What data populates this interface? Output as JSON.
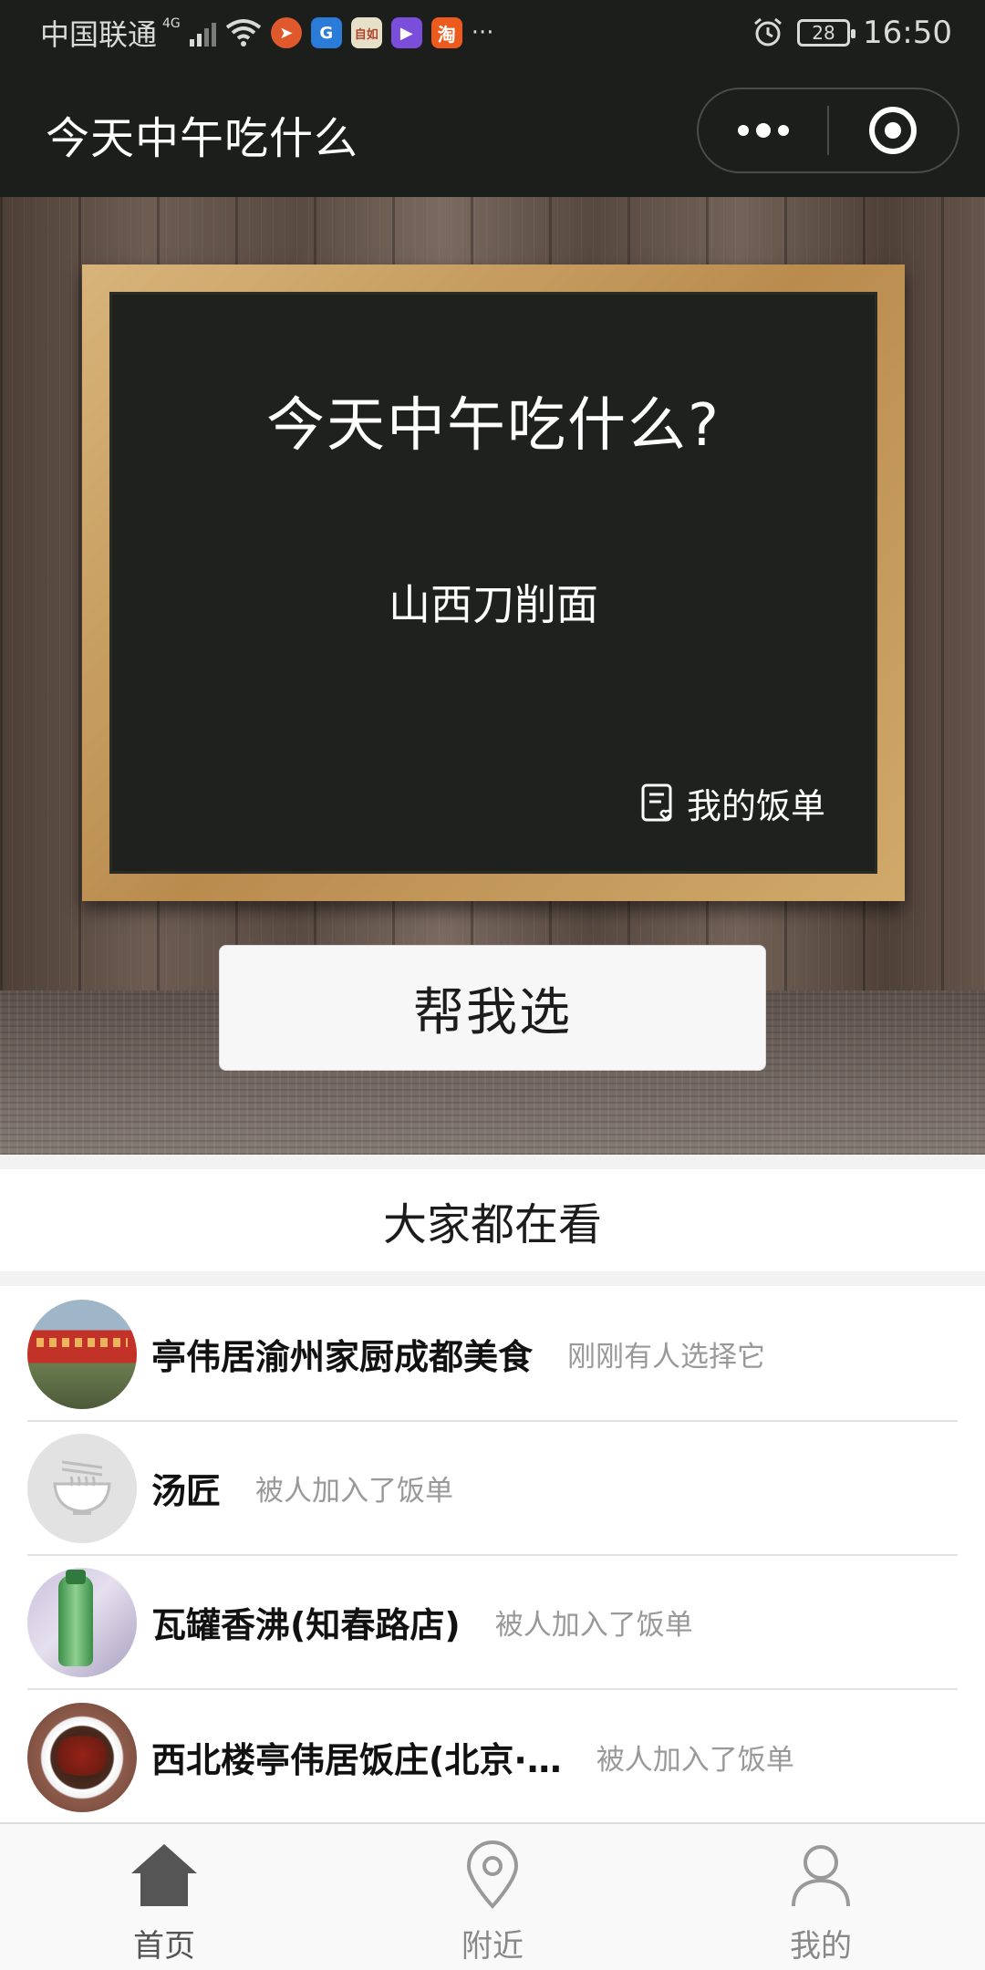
{
  "status_bar": {
    "carrier": "中国联通",
    "network": "4G",
    "time": "16:50",
    "battery": "28",
    "overflow": "···",
    "app_icons": [
      "feishu-icon",
      "browser-icon",
      "news-icon",
      "video-icon",
      "taobao-icon"
    ],
    "app_icon_texts": [
      "",
      "",
      "自如",
      "",
      "淘"
    ]
  },
  "nav": {
    "title": "今天中午吃什么"
  },
  "hero": {
    "question": "今天中午吃什么?",
    "pick": "山西刀削面",
    "menu_link": "我的饭单",
    "button": "帮我选"
  },
  "section": {
    "title": "大家都在看"
  },
  "list": [
    {
      "name": "亭伟居渝州家厨成都美食",
      "status": "刚刚有人选择它",
      "avatar": "restaurant-storefront-photo"
    },
    {
      "name": "汤匠",
      "status": "被人加入了饭单",
      "avatar": "noodle-bowl-placeholder"
    },
    {
      "name": "瓦罐香沸(知春路店)",
      "status": "被人加入了饭单",
      "avatar": "soda-bottle-photo"
    },
    {
      "name": "西北楼亭伟居饭庄(北京·…",
      "status": "被人加入了饭单",
      "avatar": "spicy-dish-photo"
    }
  ],
  "tabbar": {
    "tabs": [
      {
        "label": "首页",
        "icon": "home-icon",
        "active": true
      },
      {
        "label": "附近",
        "icon": "location-pin-icon",
        "active": false
      },
      {
        "label": "我的",
        "icon": "person-icon",
        "active": false
      }
    ]
  },
  "colors": {
    "bar_bg": "#1c1e1b",
    "chalkboard": "#1f211e",
    "frame": "#c89c5e",
    "muted_text": "#999999",
    "active_tab": "#555555",
    "inactive_tab": "#888888"
  }
}
